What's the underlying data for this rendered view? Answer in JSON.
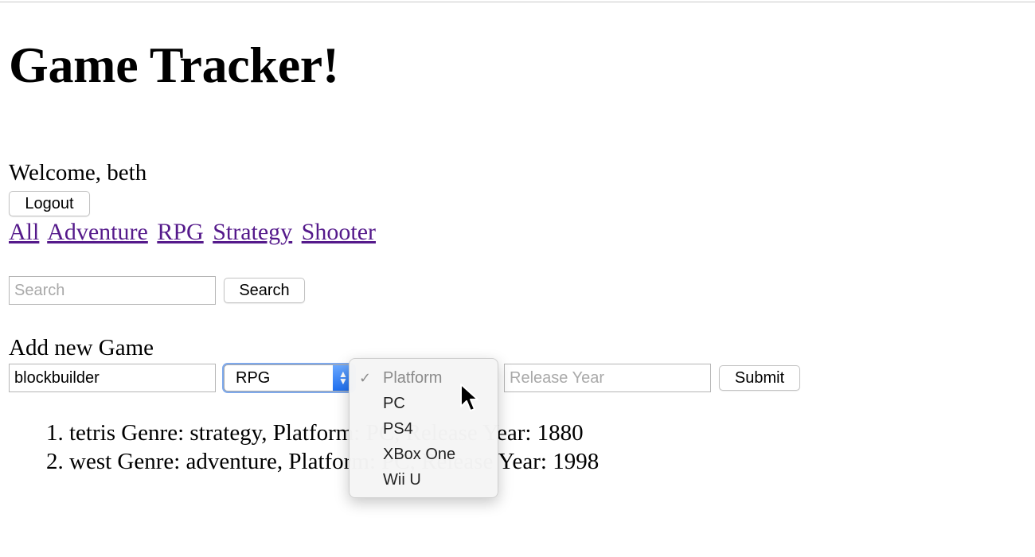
{
  "app": {
    "title": "Game Tracker!"
  },
  "welcome": {
    "prefix": "Welcome, ",
    "user": "beth"
  },
  "logout_label": "Logout",
  "nav": {
    "items": [
      "All",
      "Adventure",
      "RPG",
      "Strategy",
      "Shooter"
    ]
  },
  "search": {
    "placeholder": "Search",
    "button_label": "Search"
  },
  "add_game": {
    "heading": "Add new Game",
    "name_value": "blockbuilder",
    "genre_selected": "RPG",
    "year_placeholder": "Release Year",
    "submit_label": "Submit"
  },
  "platform_dropdown": {
    "options": [
      {
        "label": "Platform",
        "checked": true,
        "disabled": true
      },
      {
        "label": "PC"
      },
      {
        "label": "PS4"
      },
      {
        "label": "XBox One"
      },
      {
        "label": "Wii U"
      }
    ]
  },
  "games": [
    {
      "number": "1.",
      "text": "tetris Genre: strategy, Platform: PC, Release Year: 1880"
    },
    {
      "number": "2.",
      "text": "west Genre: adventure, Platform: PC, Release Year: 1998"
    }
  ],
  "icons": {
    "select_arrows": "select-stepper-icon",
    "check": "checkmark-icon",
    "cursor": "mouse-pointer-icon"
  }
}
